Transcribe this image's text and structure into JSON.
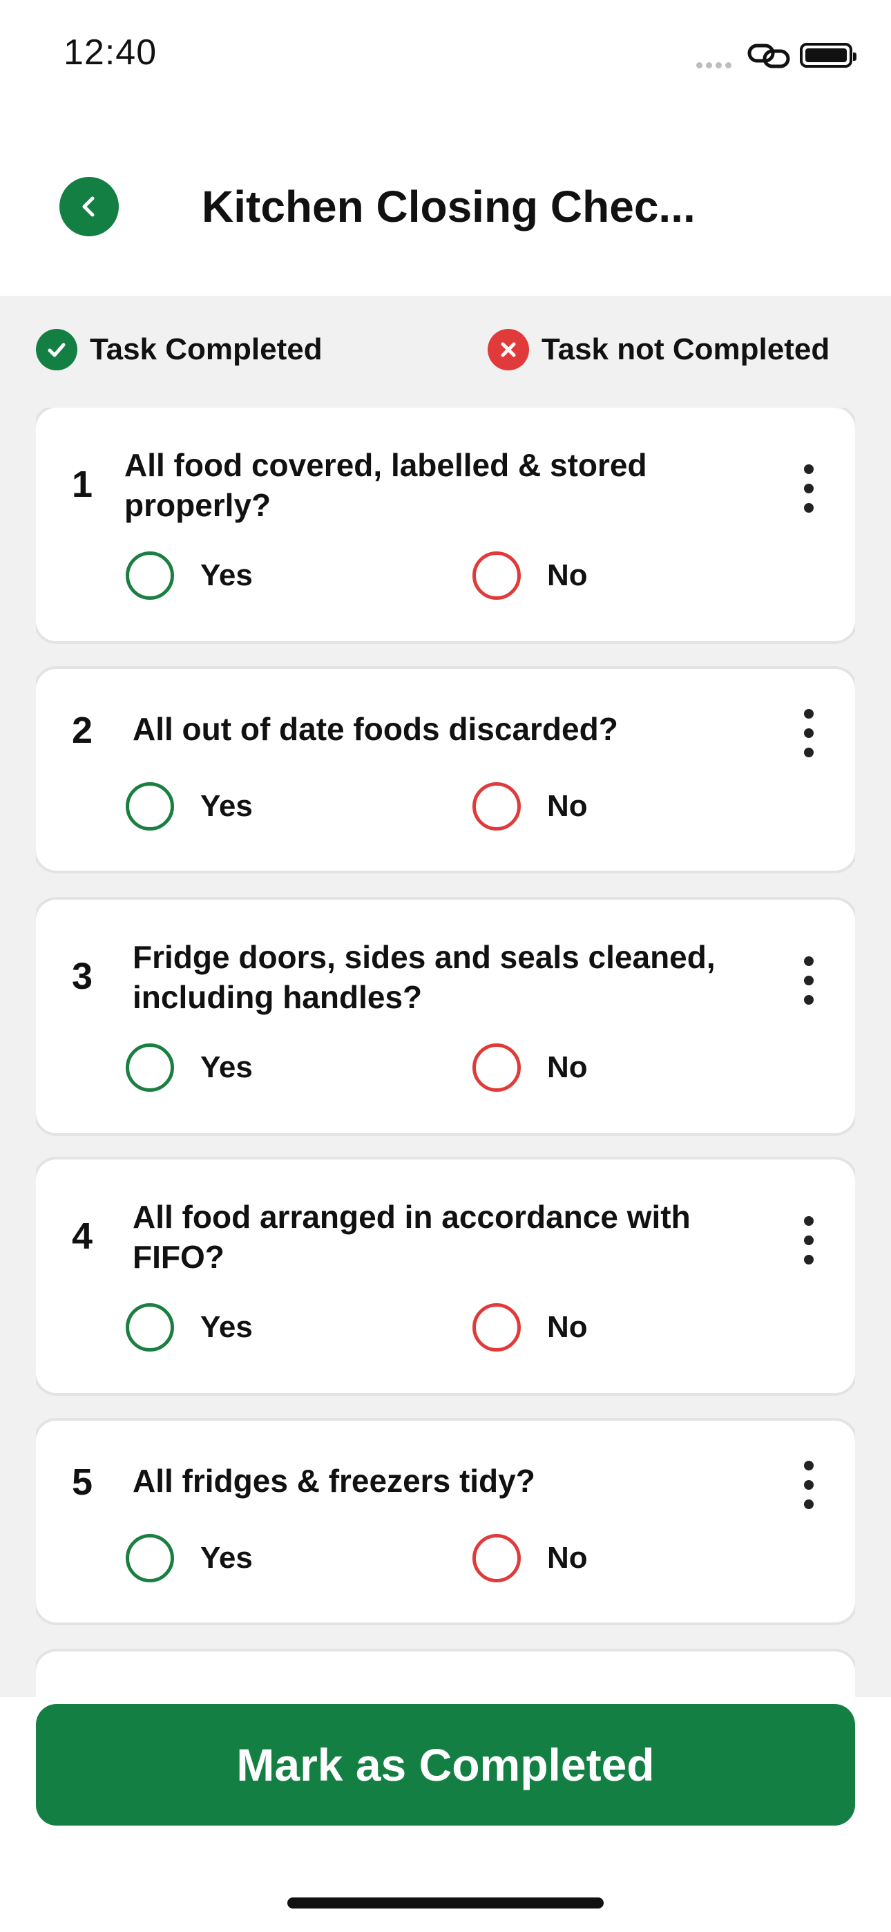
{
  "status_bar": {
    "time": "12:40"
  },
  "header": {
    "title": "Kitchen Closing Chec..."
  },
  "legend": {
    "completed_label": "Task Completed",
    "not_completed_label": "Task not Completed"
  },
  "tasks": [
    {
      "number": "1",
      "question": "All food covered, labelled & stored properly?",
      "yes_label": "Yes",
      "no_label": "No"
    },
    {
      "number": "2",
      "question": "All out of date foods discarded?",
      "yes_label": "Yes",
      "no_label": "No"
    },
    {
      "number": "3",
      "question": "Fridge doors, sides and seals cleaned, including handles?",
      "yes_label": "Yes",
      "no_label": "No"
    },
    {
      "number": "4",
      "question": "All food arranged in accordance with FIFO?",
      "yes_label": "Yes",
      "no_label": "No"
    },
    {
      "number": "5",
      "question": "All fridges & freezers tidy?",
      "yes_label": "Yes",
      "no_label": "No"
    }
  ],
  "footer": {
    "primary_button": "Mark as Completed"
  },
  "colors": {
    "primary_green": "#137f43",
    "danger_red": "#e03a3a",
    "background": "#f1f1f1"
  }
}
